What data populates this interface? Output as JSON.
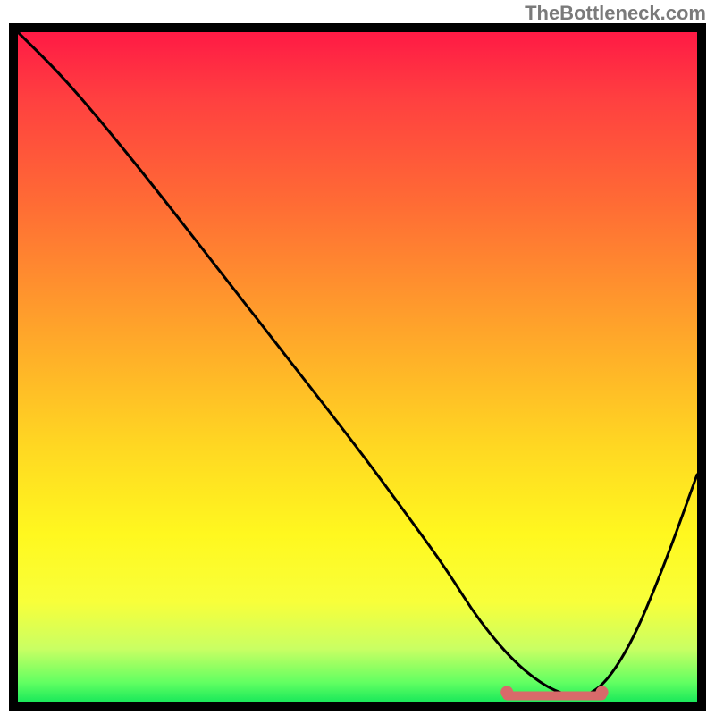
{
  "watermark": "TheBottleneck.com",
  "chart_data": {
    "type": "line",
    "title": "",
    "xlabel": "",
    "ylabel": "",
    "xlim": [
      0,
      100
    ],
    "ylim": [
      0,
      100
    ],
    "series": [
      {
        "name": "curve",
        "x": [
          0,
          6,
          12,
          20,
          30,
          40,
          50,
          58,
          63,
          68,
          74,
          80,
          85,
          90,
          95,
          100
        ],
        "values": [
          100,
          94,
          87,
          77,
          64,
          51,
          38,
          27,
          20,
          12,
          5,
          1,
          1,
          8,
          20,
          34
        ]
      }
    ],
    "highlight_segment": {
      "x_start": 72,
      "x_end": 86,
      "y": 1
    },
    "gradient_stops": [
      {
        "pos": 0,
        "color": "#ff1a45"
      },
      {
        "pos": 25,
        "color": "#ff6a35"
      },
      {
        "pos": 62,
        "color": "#ffd822"
      },
      {
        "pos": 85,
        "color": "#f8ff3a"
      },
      {
        "pos": 100,
        "color": "#18e85a"
      }
    ]
  }
}
